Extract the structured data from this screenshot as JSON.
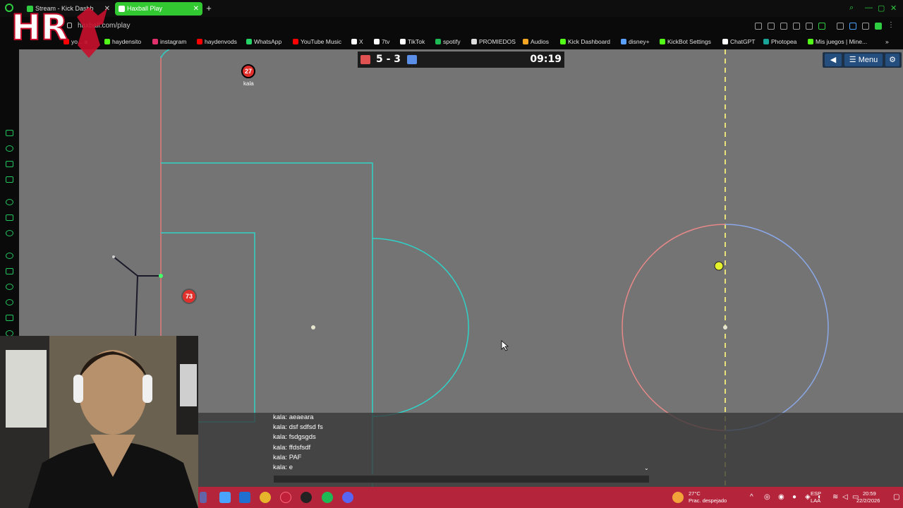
{
  "browser": {
    "tabs": [
      {
        "label": "Stream - Kick Dashb",
        "active": false
      },
      {
        "label": "Haxball Play",
        "active": true
      }
    ],
    "new_tab_glyph": "+",
    "url": "haxball.com/play",
    "bookmarks": [
      {
        "label": "yo... a",
        "icon": "youtube-icon",
        "color": "#ff0000"
      },
      {
        "label": "haydensito",
        "icon": "kick-icon",
        "color": "#53fc18"
      },
      {
        "label": "instagram",
        "icon": "instagram-icon",
        "color": "#e1306c"
      },
      {
        "label": "haydenvods",
        "icon": "youtube-icon",
        "color": "#ff0000"
      },
      {
        "label": "WhatsApp",
        "icon": "whatsapp-icon",
        "color": "#25d366"
      },
      {
        "label": "YouTube Music",
        "icon": "youtube-music-icon",
        "color": "#ff0000"
      },
      {
        "label": "X",
        "icon": "x-icon",
        "color": "#ffffff"
      },
      {
        "label": "7tv",
        "icon": "7tv-icon",
        "color": "#ffffff"
      },
      {
        "label": "TikTok",
        "icon": "tiktok-icon",
        "color": "#ffffff"
      },
      {
        "label": "spotify",
        "icon": "spotify-icon",
        "color": "#1db954"
      },
      {
        "label": "PROMIEDOS",
        "icon": "promiedos-icon",
        "color": "#dddddd"
      },
      {
        "label": "Audios",
        "icon": "audios-icon",
        "color": "#f5a623"
      },
      {
        "label": "Kick Dashboard",
        "icon": "kick-icon",
        "color": "#53fc18"
      },
      {
        "label": "disney+",
        "icon": "disney-icon",
        "color": "#5aa0ff"
      },
      {
        "label": "KickBot Settings",
        "icon": "kick-icon",
        "color": "#53fc18"
      },
      {
        "label": "ChatGPT",
        "icon": "chatgpt-icon",
        "color": "#ffffff"
      },
      {
        "label": "Photopea",
        "icon": "photopea-icon",
        "color": "#18a497"
      },
      {
        "label": "Mis juegos | Mine...",
        "icon": "kick-icon",
        "color": "#53fc18"
      }
    ],
    "bookmarks_overflow": "»"
  },
  "logo": {
    "text": "HR"
  },
  "game": {
    "score": "5 - 3",
    "timer": "09:19",
    "red_color": "#e05252",
    "blue_color": "#5b8ee6",
    "menu_label": "Menu",
    "players": [
      {
        "number": "27",
        "name": "kala"
      },
      {
        "number": "73",
        "name": ""
      }
    ]
  },
  "chat": {
    "lines": [
      "kala: aeaeara",
      "kala: dsf sdfsd fs",
      "kala: fsdgsgds",
      "kala: ffdsfsdf",
      "kala: PAF",
      "kala: e"
    ],
    "expand_glyph": "⌄"
  },
  "taskbar": {
    "weather_temp": "27°C",
    "weather_desc": "Prac. despejado",
    "lang": "ESP",
    "lang_sub": "LAA",
    "time": "20:59",
    "date": "22/2/2026"
  }
}
